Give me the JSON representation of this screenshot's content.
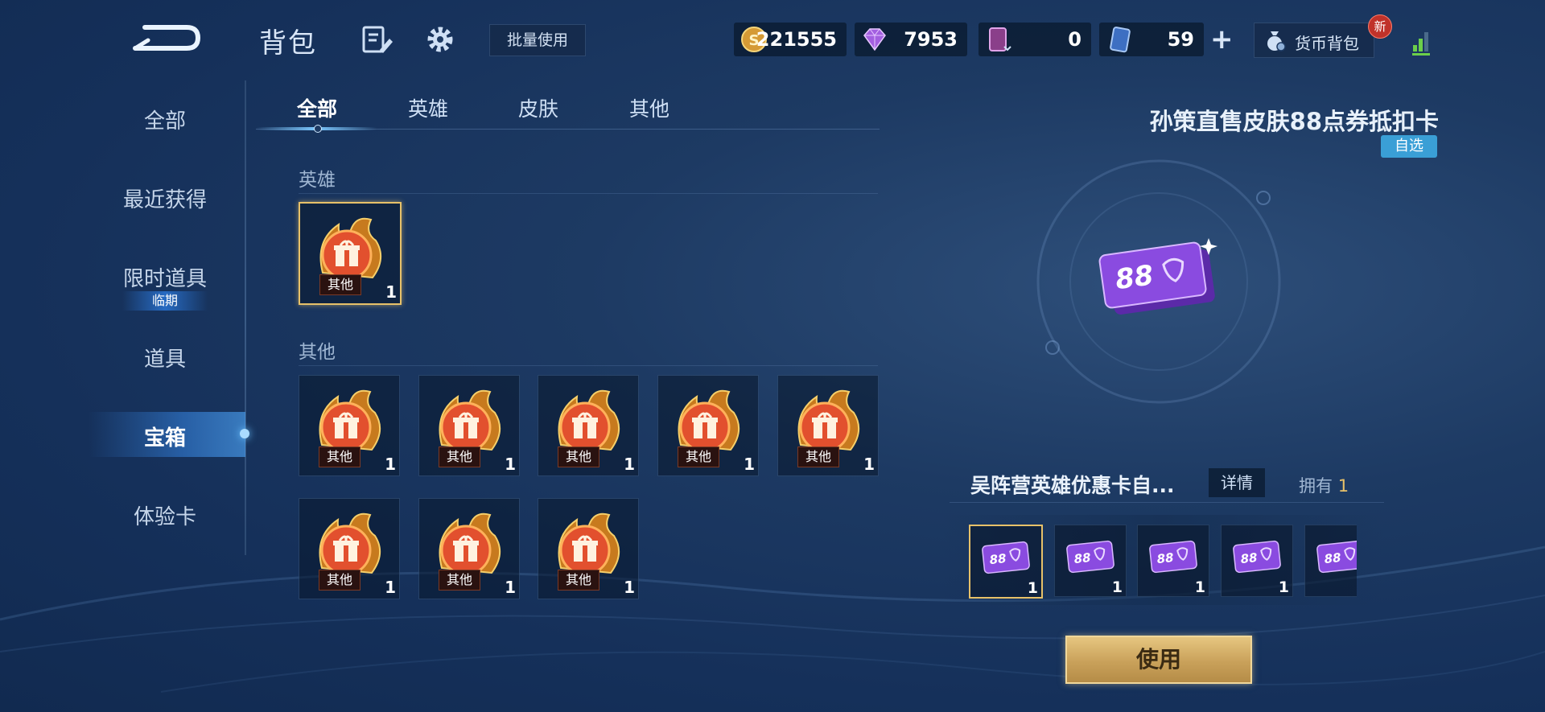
{
  "header": {
    "title": "背包",
    "batch_use_label": "批量使用",
    "currencies": [
      {
        "icon": "gold-coin-icon",
        "value": "221555"
      },
      {
        "icon": "diamond-icon",
        "value": "7953"
      },
      {
        "icon": "purple-card-icon",
        "value": "0"
      },
      {
        "icon": "blue-card-icon",
        "value": "59"
      }
    ],
    "add_symbol": "+",
    "wallet_label": "货币背包",
    "new_badge": "新"
  },
  "sidebar": {
    "items": [
      {
        "label": "全部"
      },
      {
        "label": "最近获得"
      },
      {
        "label": "限时道具",
        "tag": "临期"
      },
      {
        "label": "道具"
      },
      {
        "label": "宝箱",
        "active": true
      },
      {
        "label": "体验卡"
      }
    ]
  },
  "tabs": [
    {
      "label": "全部",
      "active": true
    },
    {
      "label": "英雄"
    },
    {
      "label": "皮肤"
    },
    {
      "label": "其他"
    }
  ],
  "sections": [
    {
      "title": "英雄",
      "items": [
        {
          "tag": "其他",
          "count": "1",
          "selected": true
        }
      ]
    },
    {
      "title": "其他",
      "items": [
        {
          "tag": "其他",
          "count": "1"
        },
        {
          "tag": "其他",
          "count": "1"
        },
        {
          "tag": "其他",
          "count": "1"
        },
        {
          "tag": "其他",
          "count": "1"
        },
        {
          "tag": "其他",
          "count": "1"
        },
        {
          "tag": "其他",
          "count": "1"
        },
        {
          "tag": "其他",
          "count": "1"
        },
        {
          "tag": "其他",
          "count": "1"
        }
      ]
    }
  ],
  "detail": {
    "title": "孙策直售皮肤88点券抵扣卡",
    "tag": "自选",
    "voucher_text": "88",
    "sub_title": "吴阵营英雄优惠卡自...",
    "detail_button": "详情",
    "own_label": "拥有",
    "own_count": "1",
    "vouchers": [
      {
        "text": "88",
        "count": "1",
        "selected": true
      },
      {
        "text": "88",
        "count": "1"
      },
      {
        "text": "88",
        "count": "1"
      },
      {
        "text": "88",
        "count": "1"
      },
      {
        "text": "88",
        "count": ""
      }
    ],
    "use_button": "使用"
  },
  "colors": {
    "accent_gold": "#e7c169",
    "tag_blue": "#3a9fd6",
    "badge_red": "#c0322a",
    "voucher_purple": "#8a4be0"
  }
}
